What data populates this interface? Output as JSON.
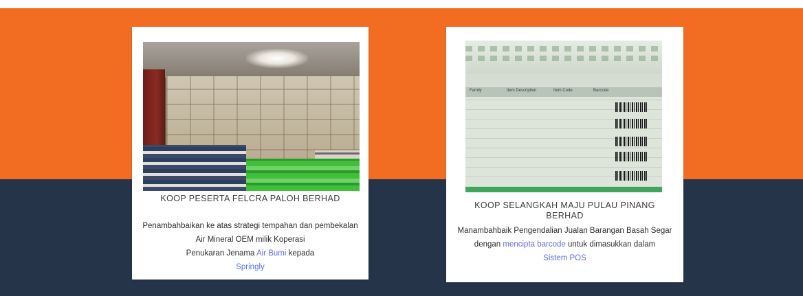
{
  "colors": {
    "orange": "#f26d21",
    "navy": "#26344a",
    "link": "#5b6cf0"
  },
  "cards": [
    {
      "title": "KOOP PESERTA FELCRA PALOH BERHAD",
      "desc_line1": "Penambahbaikan ke atas strategi tempahan dan pembekalan Air Mineral OEM milik Koperasi",
      "desc_line2_pre": "Penukaran Jenama ",
      "desc_line2_link1": "Air Bumi",
      "desc_line2_mid": " kepada ",
      "desc_line2_link2": "Springly"
    },
    {
      "title": "KOOP SELANGKAH MAJU PULAU PINANG BERHAD",
      "desc_pre": "Manambahbaik Pengendalian Jualan Barangan Basah Segar dengan ",
      "desc_link1": "mencipta barcode",
      "desc_mid": " untuk dimasukkan dalam ",
      "desc_link2": "Sistem POS"
    }
  ],
  "sheet_headers": [
    "Family",
    "Item Description",
    "Item Code",
    "Barcode"
  ]
}
